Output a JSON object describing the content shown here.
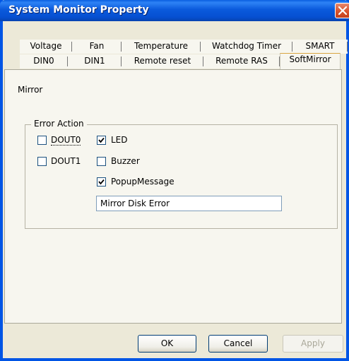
{
  "window": {
    "title": "System Monitor Property"
  },
  "tabs_row1": [
    "Voltage",
    "Fan",
    "Temperature",
    "Watchdog Timer",
    "SMART"
  ],
  "tabs_row2": [
    "DIN0",
    "DIN1",
    "Remote reset",
    "Remote RAS",
    "SoftMirror"
  ],
  "active_tab": "SoftMirror",
  "panel": {
    "section_label": "Mirror",
    "group_title": "Error Action",
    "checkboxes": [
      {
        "label": "DOUT0",
        "checked": false
      },
      {
        "label": "DOUT1",
        "checked": false
      },
      {
        "label": "LED",
        "checked": true
      },
      {
        "label": "Buzzer",
        "checked": false
      },
      {
        "label": "PopupMessage",
        "checked": true
      }
    ],
    "message_value": "Mirror Disk Error"
  },
  "buttons": {
    "ok": "OK",
    "cancel": "Cancel",
    "apply": "Apply"
  }
}
